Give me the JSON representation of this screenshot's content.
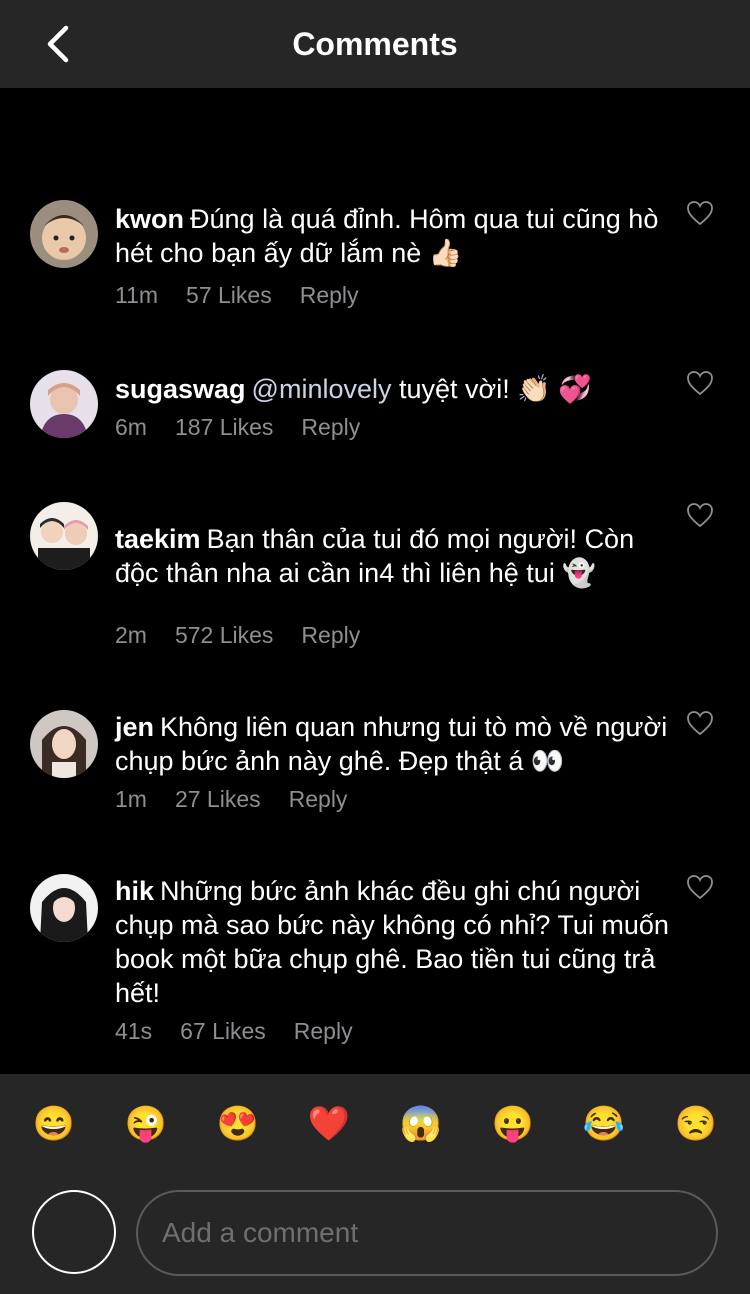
{
  "header": {
    "title": "Comments",
    "back_icon": "chevron-left-icon"
  },
  "comments": [
    {
      "username": "kwon",
      "text": "Đúng là quá đỉnh. Hôm qua tui cũng hò hét cho bạn ấy dữ lắm nè 👍🏻",
      "time": "11m",
      "likes": "57 Likes",
      "reply": "Reply"
    },
    {
      "username": "sugaswag",
      "mention": "@minlovely",
      "text": "tuyệt vời! 👏🏻 💞",
      "time": "6m",
      "likes": "187 Likes",
      "reply": "Reply"
    },
    {
      "username": "taekim",
      "text": "Bạn thân của tui đó mọi người! Còn độc thân nha ai cần in4 thì liên hệ tui 👻",
      "time": "2m",
      "likes": "572 Likes",
      "reply": "Reply"
    },
    {
      "username": "jen",
      "text": "Không liên quan nhưng tui tò mò về người chụp bức ảnh này ghê. Đẹp thật á 👀",
      "time": "1m",
      "likes": "27 Likes",
      "reply": "Reply"
    },
    {
      "username": "hik",
      "text": "Những bức ảnh khác đều ghi chú người chụp mà sao bức này không có nhỉ? Tui muốn book một bữa chụp ghê. Bao tiền tui cũng trả hết!",
      "time": "41s",
      "likes": "67 Likes",
      "reply": "Reply"
    }
  ],
  "emoji_bar": [
    "😄",
    "😜",
    "😍",
    "❤️",
    "😱",
    "😛",
    "😂",
    "😒"
  ],
  "composer": {
    "placeholder": "Add a comment"
  },
  "colors": {
    "header_bg": "#262626",
    "meta_text": "#8e8e93",
    "background": "#000000"
  }
}
